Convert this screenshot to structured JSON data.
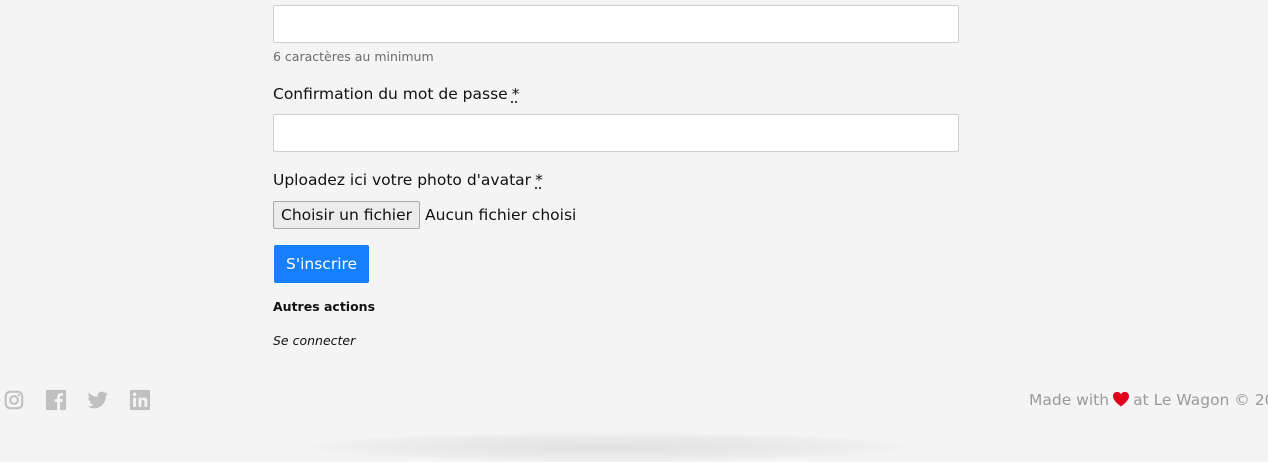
{
  "form": {
    "password_hint": "6 caractères au minimum",
    "confirm_label": "Confirmation du mot de passe",
    "required_marker": "*",
    "avatar_label": "Uploadez ici votre photo d'avatar",
    "file_button": "Choisir un fichier",
    "file_status": "Aucun fichier choisi",
    "submit": "S'inscrire"
  },
  "other_actions": {
    "title": "Autres actions",
    "login_link": "Se connecter"
  },
  "footer": {
    "socials": [
      "instagram-icon",
      "facebook-icon",
      "twitter-icon",
      "linkedin-icon"
    ],
    "made_with": "Made with",
    "at_text": "at Le Wagon © 20",
    "heart_color": "#e0001b",
    "icon_color": "#c0c0c0"
  },
  "colors": {
    "background": "#f4f4f4",
    "primary_button": "#167ffc"
  }
}
